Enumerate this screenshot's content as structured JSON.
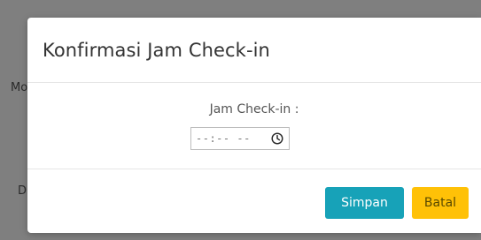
{
  "background": {
    "text_1": "Mo",
    "text_2": "D"
  },
  "modal": {
    "title": "Konfirmasi Jam Check-in",
    "field_label": "Jam Check-in :",
    "time_value": "--:-- --",
    "time_icon": "clock-icon",
    "buttons": {
      "save_label": "Simpan",
      "cancel_label": "Batal"
    }
  },
  "colors": {
    "overlay": "#7f7f7f",
    "primary": "#17a2b8",
    "warning": "#ffc107"
  }
}
